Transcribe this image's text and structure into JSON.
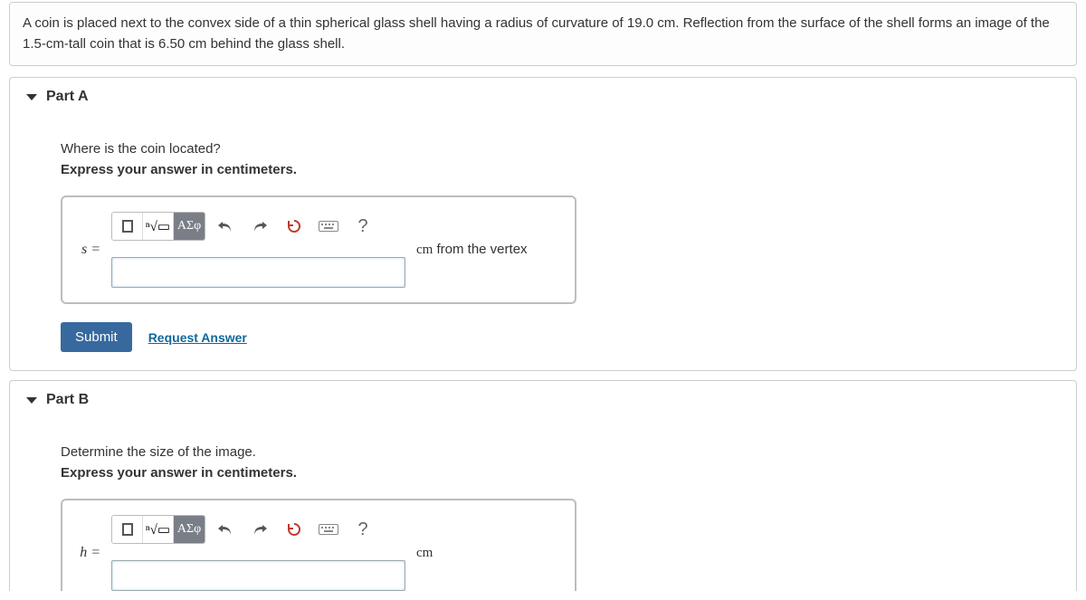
{
  "problem": {
    "text": "A coin is placed next to the convex side of a thin spherical glass shell having a radius of curvature of 19.0 cm. Reflection from the surface of the shell forms an image of the 1.5-cm-tall coin that is 6.50 cm behind the glass shell."
  },
  "partA": {
    "title": "Part A",
    "prompt": "Where is the coin located?",
    "instruction": "Express your answer in centimeters.",
    "varLabel": "s =",
    "unit_cm": "cm",
    "unit_rest": " from the vertex",
    "toolbar": {
      "greek": "ΑΣφ",
      "help": "?"
    },
    "submit": "Submit",
    "request": "Request Answer"
  },
  "partB": {
    "title": "Part B",
    "prompt": "Determine the size of the image.",
    "instruction": "Express your answer in centimeters.",
    "varLabel": "h =",
    "unit": "cm",
    "toolbar": {
      "greek": "ΑΣφ",
      "help": "?"
    }
  }
}
